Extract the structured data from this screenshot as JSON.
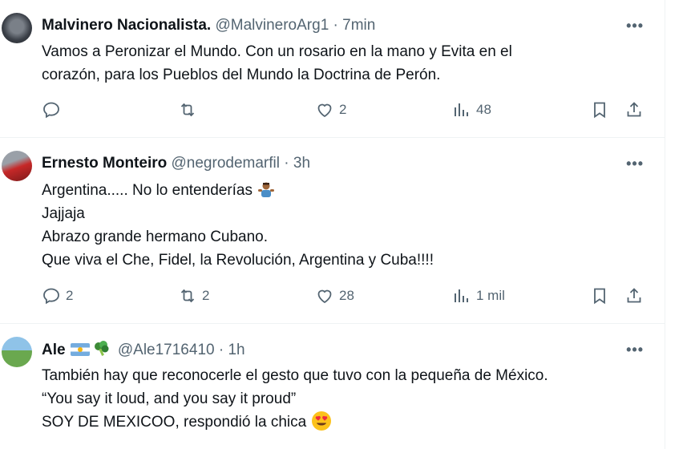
{
  "tweets": [
    {
      "name": "Malvinero Nacionalista.",
      "handle": "@MalvineroArg1",
      "time": "7min",
      "lines": [
        "Vamos a Peronizar el Mundo. Con un rosario en la mano y Evita en el",
        "corazón, para los Pueblos del Mundo la Doctrina de Perón."
      ],
      "replies": "",
      "retweets": "",
      "likes": "2",
      "views": "48"
    },
    {
      "name": "Ernesto Monteiro",
      "handle": "@negrodemarfil",
      "time": "3h",
      "lines": [
        "Argentina..... No lo entenderías",
        "Jajjaja",
        "Abrazo grande hermano Cubano.",
        "Que viva el Che, Fidel, la Revolución, Argentina y Cuba!!!!"
      ],
      "replies": "2",
      "retweets": "2",
      "likes": "28",
      "views": "1 mil"
    },
    {
      "name": "Ale",
      "handle": "@Ale1716410",
      "time": "1h",
      "lines": [
        "También hay que reconocerle el gesto que tuvo con la pequeña de México.",
        "“You say it loud, and you say it proud”",
        "SOY DE MEXICOO, respondió la chica"
      ]
    }
  ],
  "separator": "·",
  "more_label": "•••"
}
